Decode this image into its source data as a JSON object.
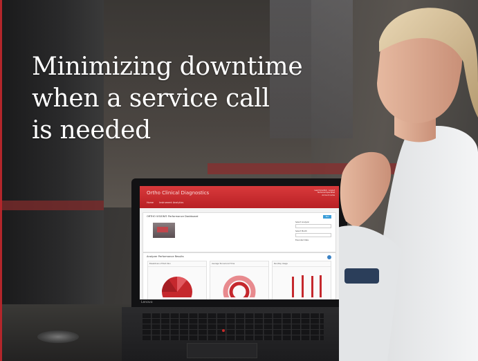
{
  "headline": {
    "lines": [
      "Minimizing downtime",
      "when a service call",
      "is needed"
    ]
  },
  "laptop": {
    "bezel_brand": "Lenovo",
    "screen": {
      "brand": "Ortho Clinical Diagnostics",
      "user_info": [
        "Lead Scientist · Logout",
        "Technical Specialist",
        "Account name"
      ],
      "nav": [
        "Home",
        "Instrument Analytics"
      ],
      "panel_title": "ORTHO VISION® Performance Dashboard",
      "panel_button": "Run",
      "select_labels": [
        "Select Analyzer",
        "Select Month",
        "Executed Date"
      ],
      "perf_title": "Analyzer Performance Results",
      "cards": [
        "Breakdown of Each Run",
        "Average Turnaround Time",
        "Run/Day Usage"
      ]
    }
  },
  "colors": {
    "header_red": "#c62b2f",
    "chart_red": "#c5282d",
    "chart_blue_dot": "#3b82c4"
  }
}
